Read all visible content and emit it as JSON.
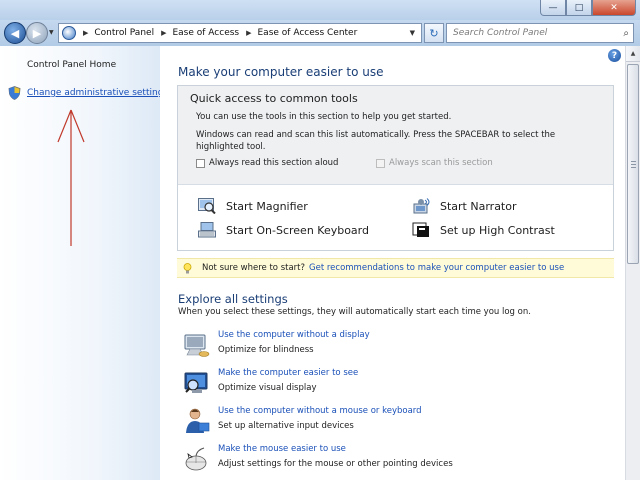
{
  "window": {
    "minimize_glyph": "—",
    "maximize_glyph": "□",
    "close_glyph": "✕"
  },
  "address_bar": {
    "breadcrumbs": [
      "Control Panel",
      "Ease of Access",
      "Ease of Access Center"
    ],
    "search_placeholder": "Search Control Panel"
  },
  "left_pane": {
    "home_label": "Control Panel Home",
    "admin_link": "Change administrative settings",
    "arrow_color": "#c0392b"
  },
  "main": {
    "heading": "Make your computer easier to use",
    "quick_access": {
      "title": "Quick access to common tools",
      "line1": "You can use the tools in this section to help you get started.",
      "line2": "Windows can read and scan this list automatically.  Press the SPACEBAR to select the highlighted tool.",
      "checkbox_read": "Always read this section aloud",
      "checkbox_scan": "Always scan this section",
      "tools": [
        "Start Magnifier",
        "Start Narrator",
        "Start On-Screen Keyboard",
        "Set up High Contrast"
      ]
    },
    "tip": {
      "question": "Not sure where to start?",
      "link": "Get recommendations to make your computer easier to use"
    },
    "explore": {
      "heading": "Explore all settings",
      "subtitle": "When you select these settings, they will automatically start each time you log on.",
      "items": [
        {
          "link": "Use the computer without a display",
          "desc": "Optimize for blindness"
        },
        {
          "link": "Make the computer easier to see",
          "desc": "Optimize visual display"
        },
        {
          "link": "Use the computer without a mouse or keyboard",
          "desc": "Set up alternative input devices"
        },
        {
          "link": "Make the mouse easier to use",
          "desc": "Adjust settings for the mouse or other pointing devices"
        }
      ]
    }
  },
  "colors": {
    "link": "#1a50b8",
    "heading": "#1a3e76",
    "tip_background": "#fffbd8"
  }
}
